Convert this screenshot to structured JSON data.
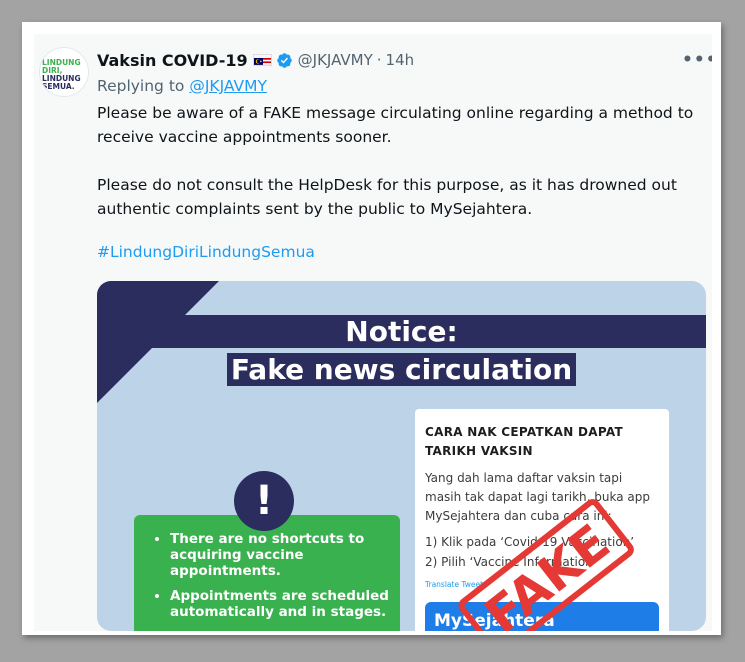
{
  "tweet": {
    "author_name": "Vaksin COVID-19",
    "flag_icon": "malaysia-flag-icon",
    "verified_icon": "verified-badge-icon",
    "handle": "@JKJAVMY",
    "separator": "·",
    "time": "14h",
    "more_label": "•••",
    "replying_prefix": "Replying to",
    "replying_handle": "@JKJAVMY",
    "paragraph_1": "Please be aware of a FAKE message circulating online regarding a method to receive vaccine appointments sooner.",
    "paragraph_2": "Please do not consult the HelpDesk for this purpose, as it has drowned out authentic complaints sent by the public to MySejahtera.",
    "hashtag": "#LindungDiriLindungSemua",
    "avatar": {
      "line1": "LINDUNG",
      "line2": "DIRI,",
      "line3": "LINDUNG",
      "line4": "SEMUA."
    }
  },
  "media": {
    "notice_line1": "Notice:",
    "notice_line2": "Fake news circulation",
    "alert_symbol": "!",
    "bullet_1": "There are no shortcuts to acquiring vaccine appointments.",
    "bullet_2": "Appointments are scheduled automatically and in stages.",
    "phone": {
      "title": "CARA NAK CEPATKAN DAPAT TARIKH VAKSIN",
      "body": "Yang dah lama daftar vaksin tapi masih tak dapat lagi tarikh, buka app MySejahtera dan cuba cara ini:",
      "step_1": "1) Klik pada ‘Covid-19 Vaccination’",
      "step_2": "2) Pilih ‘Vaccine Information’",
      "translate": "Translate Tweet",
      "banner": "MySejahtera"
    },
    "stamp_text": "FAKE",
    "colors": {
      "background": "#bcd3e8",
      "navy": "#2a2d5e",
      "green": "#3ab14f",
      "stamp": "#e53935"
    }
  }
}
